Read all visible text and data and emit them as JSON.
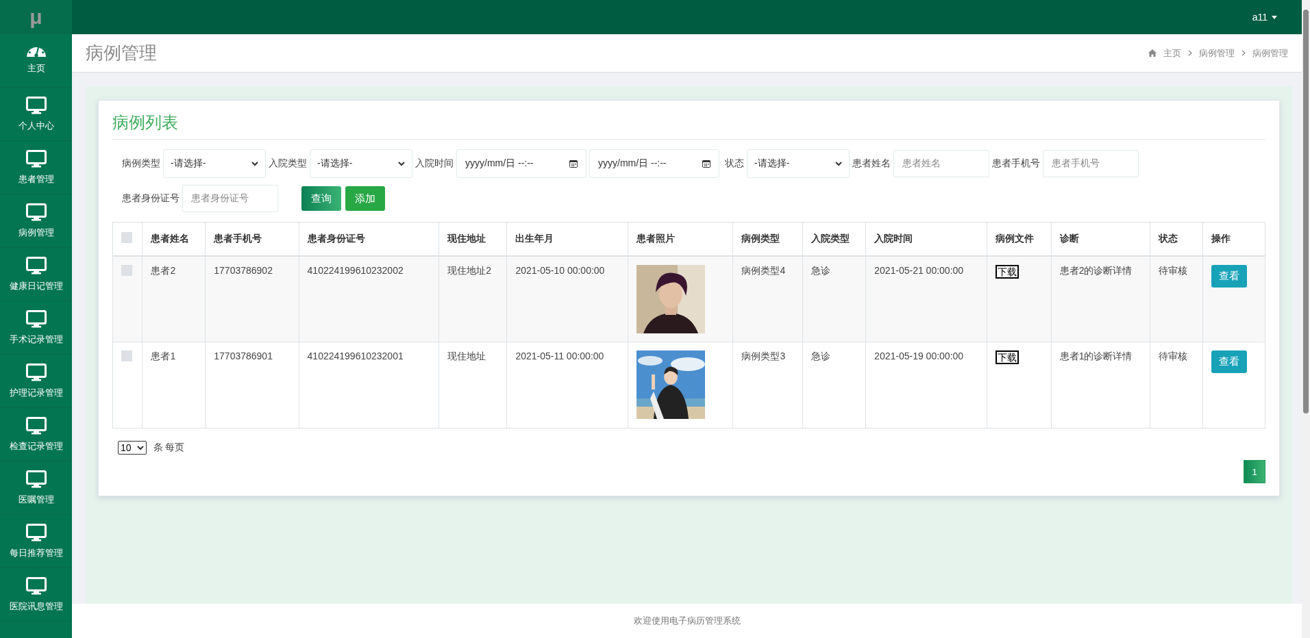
{
  "brand": "μ",
  "user": {
    "name": "a11"
  },
  "sidebar": {
    "items": [
      {
        "label": "主页",
        "kind": "dashboard",
        "selected": false
      },
      {
        "label": "个人中心",
        "kind": "monitor",
        "selected": false
      },
      {
        "label": "患者管理",
        "kind": "monitor",
        "selected": false
      },
      {
        "label": "病例管理",
        "kind": "monitor",
        "selected": false
      },
      {
        "label": "健康日记管理",
        "kind": "monitor",
        "selected": false
      },
      {
        "label": "手术记录管理",
        "kind": "monitor",
        "selected": false
      },
      {
        "label": "护理记录管理",
        "kind": "monitor",
        "selected": false
      },
      {
        "label": "检查记录管理",
        "kind": "monitor",
        "selected": false
      },
      {
        "label": "医嘱管理",
        "kind": "monitor",
        "selected": false
      },
      {
        "label": "每日推荐管理",
        "kind": "monitor",
        "selected": false
      },
      {
        "label": "医院讯息管理",
        "kind": "monitor",
        "selected": false
      }
    ]
  },
  "page_title": "病例管理",
  "breadcrumb": [
    "主页",
    "病例管理",
    "病例管理"
  ],
  "card_title": "病例列表",
  "filters": [
    {
      "kind": "select",
      "label": "病例类型",
      "value": "-请选择-"
    },
    {
      "kind": "select",
      "label": "入院类型",
      "value": "-请选择-"
    },
    {
      "kind": "datetime",
      "label": "入院时间",
      "placeholder": "yyyy/mm/日 --:--"
    },
    {
      "kind": "datetime",
      "placeholder": "yyyy/mm/日 --:--"
    },
    {
      "kind": "select",
      "label": "状态",
      "value": "-请选择-"
    },
    {
      "kind": "text",
      "label": "患者姓名",
      "placeholder": "患者姓名"
    },
    {
      "kind": "text",
      "label": "患者手机号",
      "placeholder": "患者手机号"
    },
    {
      "kind": "text",
      "label": "患者身份证号",
      "placeholder": "患者身份证号"
    }
  ],
  "buttons": [
    {
      "kind": "query",
      "label": "查询"
    },
    {
      "kind": "add",
      "label": "添加"
    }
  ],
  "table": {
    "header_checked": false,
    "columns": [
      "患者姓名",
      "患者手机号",
      "患者身份证号",
      "现住地址",
      "出生年月",
      "患者照片",
      "病例类型",
      "入院类型",
      "入院时间",
      "病例文件",
      "诊断",
      "状态",
      "操作"
    ],
    "rows": [
      {
        "checked": false,
        "name": "患者2",
        "phone": "17703786902",
        "id_number": "410224199610232002",
        "address": "现住地址2",
        "birth": "2021-05-10 00:00:00",
        "case_type": "病例类型4",
        "admission_type": "急诊",
        "admission_time": "2021-05-21 00:00:00",
        "file": "下载",
        "diagnosis": "患者2的诊断详情",
        "status": "待审核",
        "action": "查看"
      },
      {
        "checked": false,
        "name": "患者1",
        "phone": "17703786901",
        "id_number": "410224199610232001",
        "address": "现住地址",
        "birth": "2021-05-11 00:00:00",
        "case_type": "病例类型3",
        "admission_type": "急诊",
        "admission_time": "2021-05-19 00:00:00",
        "file": "下载",
        "diagnosis": "患者1的诊断详情",
        "status": "待审核",
        "action": "查看"
      }
    ]
  },
  "pager": {
    "page_size": "10",
    "unit": "条 每页",
    "pages": [
      {
        "label": "1",
        "selected": true
      }
    ]
  },
  "footer": "欢迎使用电子病历管理系统"
}
